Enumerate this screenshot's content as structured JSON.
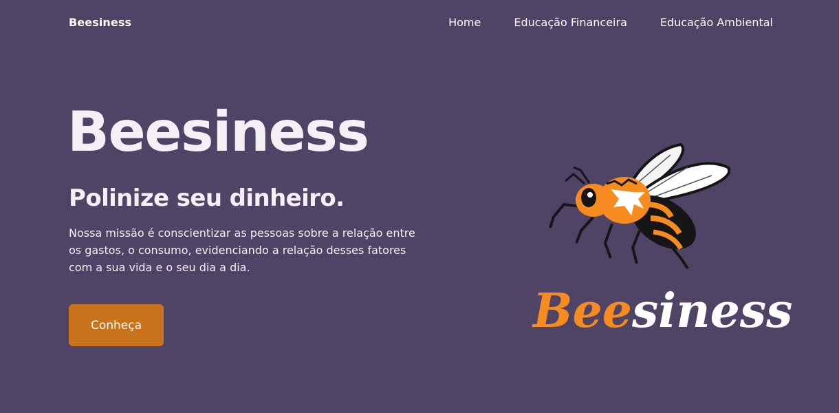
{
  "brand": {
    "name": "Beesiness"
  },
  "nav": {
    "items": [
      {
        "label": "Home"
      },
      {
        "label": "Educação Financeira"
      },
      {
        "label": "Educação Ambiental"
      }
    ]
  },
  "hero": {
    "title": "Beesiness",
    "subtitle": "Polinize seu dinheiro.",
    "description": "Nossa missão é conscientizar as pessoas sobre a relação entre os gastos, o consumo, evidenciando a relação desses fatores com a sua vida e o seu dia a dia.",
    "cta_label": "Conheça"
  },
  "logo": {
    "icon": "bee-icon",
    "wordmark_orange": "Bee",
    "wordmark_white": "siness"
  },
  "colors": {
    "background": "#504466",
    "accent": "#c9741c",
    "logo_orange": "#f68b1f",
    "text": "#ffffff"
  }
}
